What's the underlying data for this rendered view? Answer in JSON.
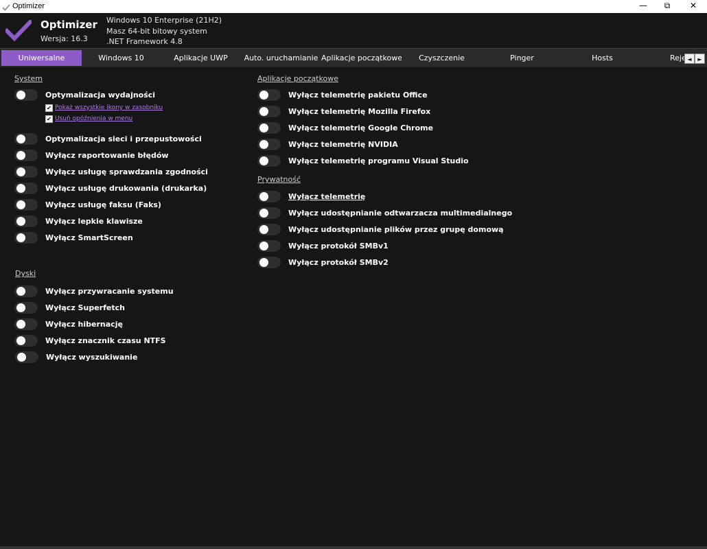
{
  "window": {
    "title": "Optimizer",
    "minimize_glyph": "—",
    "restore_glyph": "⧉",
    "close_glyph": "✕"
  },
  "header": {
    "app_name": "Optimizer",
    "version": "Wersja: 16.3",
    "sysinfo": [
      "Windows 10 Enterprise (21H2)",
      "Masz 64-bit bitowy system",
      ".NET Framework 4.8"
    ]
  },
  "tabs": [
    "Uniwersalne",
    "Windows 10",
    "Aplikacje UWP",
    "Auto. uruchamianie",
    "Aplikacje początkowe",
    "Czyszczenie",
    "Pinger",
    "Hosts",
    "Reje"
  ],
  "tab_scroll": {
    "left": "◄",
    "right": "►"
  },
  "system": {
    "title": "System",
    "perf": "Optymalizacja wydajności",
    "perf_sub": [
      "Pokaż wszystkie ikony w zasobniku",
      "Usuń opóźnienia w menu"
    ],
    "check_glyph": "✔",
    "items": [
      "Optymalizacja sieci i przepustowości",
      "Wyłącz raportowanie błędów",
      "Wyłącz usługę sprawdzania zgodności",
      "Wyłącz usługę drukowania (drukarka)",
      "Wyłącz usługę faksu (Faks)",
      "Wyłącz lepkie klawisze",
      "Wyłącz SmartScreen"
    ]
  },
  "disks": {
    "title": "Dyski",
    "items": [
      "Wyłącz przywracanie systemu",
      "Wyłącz Superfetch",
      "Wyłącz hibernację",
      "Wyłącz znacznik czasu NTFS",
      "Wyłącz wyszukiwanie"
    ]
  },
  "startup_apps": {
    "title": "Aplikacje początkowe",
    "items": [
      "Wyłącz telemetrię pakietu Office",
      "Wyłącz telemetrię Mozilla Firefox",
      "Wyłącz telemetrię Google Chrome",
      "Wyłącz telemetrię NVIDIA",
      "Wyłącz telemetrię programu Visual Studio"
    ]
  },
  "privacy": {
    "title": "Prywatność",
    "items": [
      "Wyłącz telemetrię",
      "Wyłącz udostępnianie odtwarzacza multimedialnego",
      "Wyłącz udostępnianie plików przez grupę domową",
      "Wyłącz protokół SMBv1",
      "Wyłącz protokół SMBv2"
    ]
  },
  "colors": {
    "accent": "#8e5cc8",
    "background": "#161616",
    "tabbar": "#2a2a2a",
    "toggle_off": "#2e2e2e",
    "link": "#b07ee0"
  }
}
